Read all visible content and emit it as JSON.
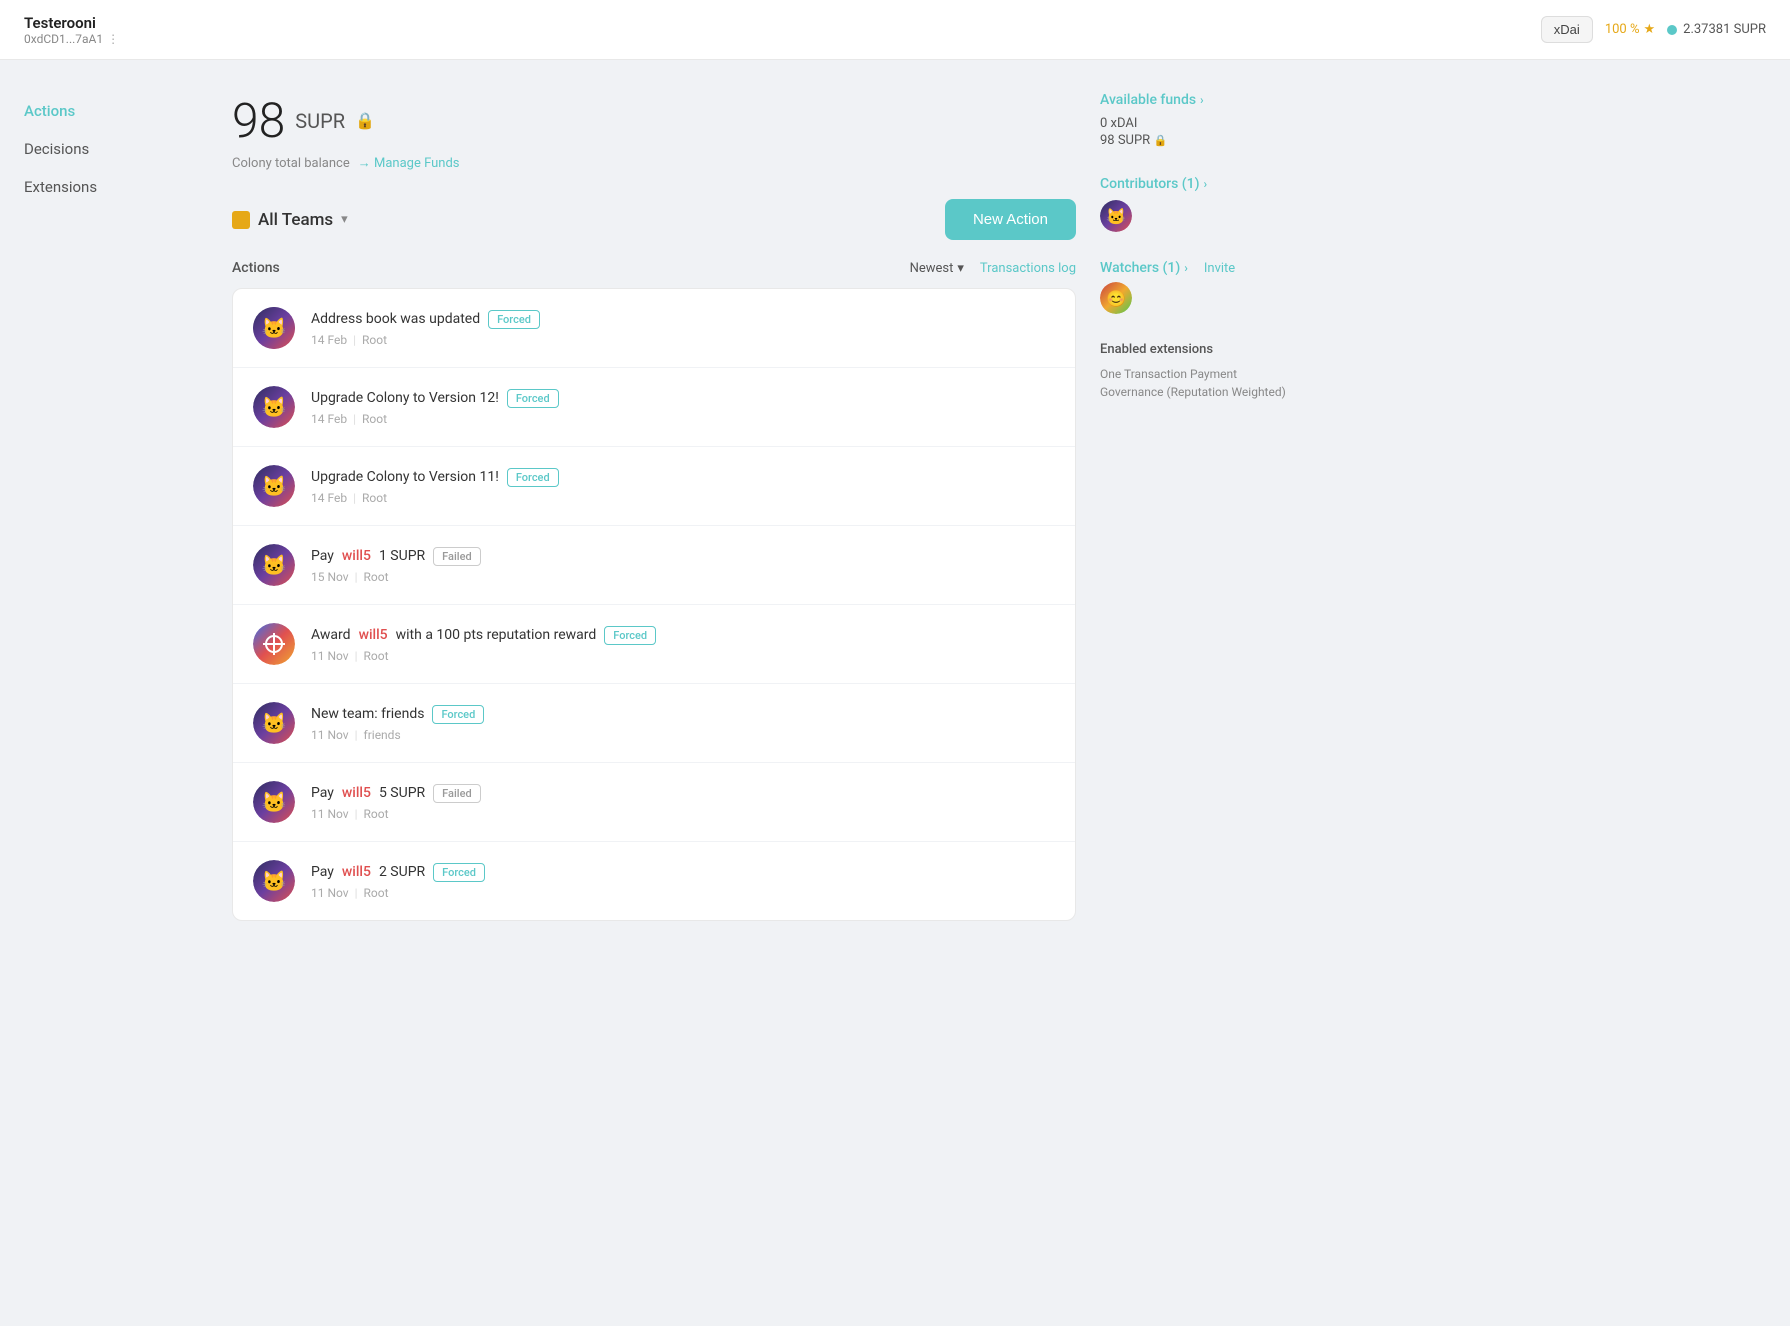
{
  "header": {
    "username": "Testerooni",
    "address": "0xdCD1...7aA1",
    "address_dots": "⋮",
    "network": "xDai",
    "percent": "100 %",
    "star": "★",
    "supr_balance": "2.37381 SUPR"
  },
  "sidebar": {
    "items": [
      {
        "label": "Actions",
        "active": true
      },
      {
        "label": "Decisions",
        "active": false
      },
      {
        "label": "Extensions",
        "active": false
      }
    ]
  },
  "balance": {
    "amount": "98",
    "token": "SUPR",
    "lock": "🔒",
    "subtitle": "Colony total balance",
    "manage_funds": "→ Manage Funds"
  },
  "teams": {
    "label": "All Teams",
    "chevron": "▾"
  },
  "new_action_btn": "New Action",
  "actions_list": {
    "title": "Actions",
    "sort_label": "Newest",
    "sort_chevron": "▾",
    "transactions_log": "Transactions log"
  },
  "actions": [
    {
      "id": 1,
      "avatar_type": "cat",
      "emoji": "🐱",
      "title_parts": [
        "Address book was updated"
      ],
      "highlight": null,
      "badge": "Forced",
      "badge_type": "forced",
      "date": "14 Feb",
      "team": "Root"
    },
    {
      "id": 2,
      "avatar_type": "cat",
      "emoji": "🐱",
      "title_parts": [
        "Upgrade Colony to Version 12!"
      ],
      "highlight": null,
      "badge": "Forced",
      "badge_type": "forced",
      "date": "14 Feb",
      "team": "Root"
    },
    {
      "id": 3,
      "avatar_type": "cat",
      "emoji": "🐱",
      "title_parts": [
        "Upgrade Colony to Version 11!"
      ],
      "highlight": null,
      "badge": "Forced",
      "badge_type": "forced",
      "date": "14 Feb",
      "team": "Root"
    },
    {
      "id": 4,
      "avatar_type": "cat",
      "emoji": "🐱",
      "title_prefix": "Pay ",
      "title_highlight": "will5",
      "title_suffix": " 1 SUPR",
      "badge": "Failed",
      "badge_type": "failed",
      "date": "15 Nov",
      "team": "Root"
    },
    {
      "id": 5,
      "avatar_type": "crosshair",
      "emoji": "🎯",
      "title_prefix": "Award ",
      "title_highlight": "will5",
      "title_suffix": " with a 100 pts reputation reward",
      "badge": "Forced",
      "badge_type": "forced",
      "date": "11 Nov",
      "team": "Root"
    },
    {
      "id": 6,
      "avatar_type": "cat",
      "emoji": "🐱",
      "title_parts": [
        "New team: friends"
      ],
      "highlight": null,
      "badge": "Forced",
      "badge_type": "forced",
      "date": "11 Nov",
      "team": "friends"
    },
    {
      "id": 7,
      "avatar_type": "cat",
      "emoji": "🐱",
      "title_prefix": "Pay ",
      "title_highlight": "will5",
      "title_suffix": " 5 SUPR",
      "badge": "Failed",
      "badge_type": "failed",
      "date": "11 Nov",
      "team": "Root"
    },
    {
      "id": 8,
      "avatar_type": "cat",
      "emoji": "🐱",
      "title_prefix": "Pay ",
      "title_highlight": "will5",
      "title_suffix": " 2 SUPR",
      "badge": "Forced",
      "badge_type": "forced",
      "date": "11 Nov",
      "team": "Root"
    }
  ],
  "right_panel": {
    "available_funds_label": "Available funds",
    "xdai_value": "0 xDAI",
    "supr_value": "98 SUPR",
    "contributors_label": "Contributors (1)",
    "watchers_label": "Watchers (1)",
    "invite_label": "Invite",
    "enabled_extensions_label": "Enabled extensions",
    "extensions": [
      "One Transaction Payment",
      "Governance (Reputation Weighted)"
    ]
  },
  "colors": {
    "accent": "#5bc8c8",
    "highlight_red": "#e05050",
    "badge_border_forced": "#5bc8c8",
    "badge_border_failed": "#ccc"
  }
}
